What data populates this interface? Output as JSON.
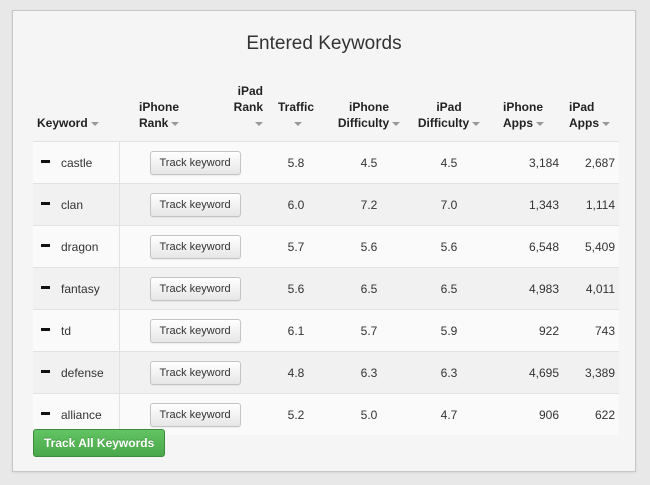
{
  "title": "Entered Keywords",
  "columns": [
    {
      "key": "keyword",
      "label": "Keyword"
    },
    {
      "key": "iphone_rank",
      "line1": "iPhone",
      "line2": "Rank"
    },
    {
      "key": "ipad_rank",
      "line1": "iPad",
      "line2": "Rank"
    },
    {
      "key": "traffic",
      "line1": "Traffic",
      "line2": ""
    },
    {
      "key": "iphone_difficulty",
      "line1": "iPhone",
      "line2": "Difficulty"
    },
    {
      "key": "ipad_difficulty",
      "line1": "iPad",
      "line2": "Difficulty"
    },
    {
      "key": "iphone_apps",
      "line1": "iPhone",
      "line2": "Apps"
    },
    {
      "key": "ipad_apps",
      "line1": "iPad",
      "line2": "Apps"
    }
  ],
  "track_button_label": "Track keyword",
  "track_all_label": "Track All Keywords",
  "rows": [
    {
      "keyword": "castle",
      "traffic": "5.8",
      "iphone_difficulty": "4.5",
      "ipad_difficulty": "4.5",
      "iphone_apps": "3,184",
      "ipad_apps": "2,687"
    },
    {
      "keyword": "clan",
      "traffic": "6.0",
      "iphone_difficulty": "7.2",
      "ipad_difficulty": "7.0",
      "iphone_apps": "1,343",
      "ipad_apps": "1,114"
    },
    {
      "keyword": "dragon",
      "traffic": "5.7",
      "iphone_difficulty": "5.6",
      "ipad_difficulty": "5.6",
      "iphone_apps": "6,548",
      "ipad_apps": "5,409"
    },
    {
      "keyword": "fantasy",
      "traffic": "5.6",
      "iphone_difficulty": "6.5",
      "ipad_difficulty": "6.5",
      "iphone_apps": "4,983",
      "ipad_apps": "4,011"
    },
    {
      "keyword": "td",
      "traffic": "6.1",
      "iphone_difficulty": "5.7",
      "ipad_difficulty": "5.9",
      "iphone_apps": "922",
      "ipad_apps": "743"
    },
    {
      "keyword": "defense",
      "traffic": "4.8",
      "iphone_difficulty": "6.3",
      "ipad_difficulty": "6.3",
      "iphone_apps": "4,695",
      "ipad_apps": "3,389"
    },
    {
      "keyword": "alliance",
      "traffic": "5.2",
      "iphone_difficulty": "5.0",
      "ipad_difficulty": "4.7",
      "iphone_apps": "906",
      "ipad_apps": "622"
    }
  ],
  "colors": {
    "panel_bg": "#f5f5f5",
    "row_odd": "#fafafa",
    "row_even": "#f1f1f1",
    "track_all_bg": "#5bb75b"
  }
}
